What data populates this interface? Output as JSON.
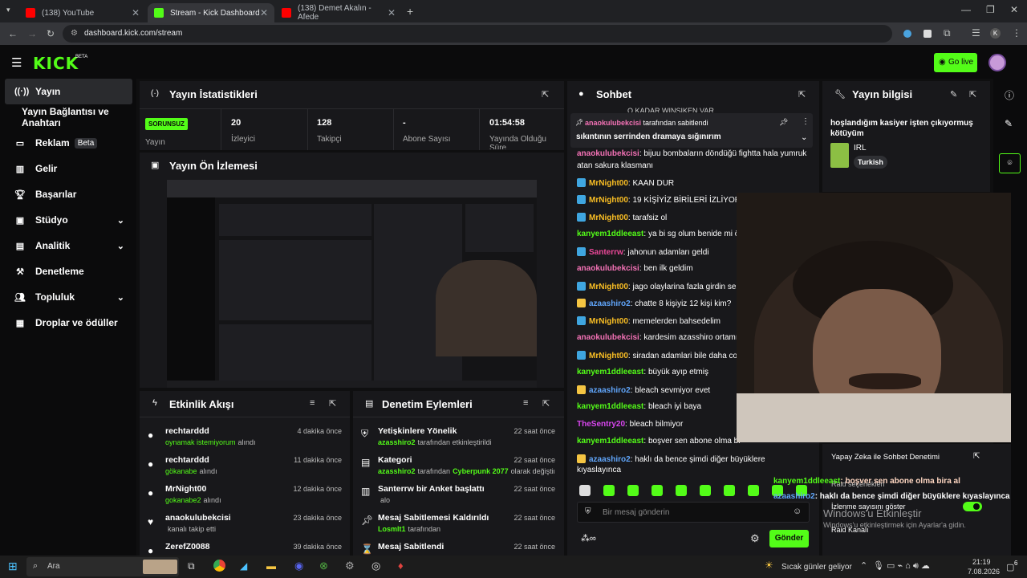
{
  "browser": {
    "tabs": [
      {
        "label": "(138) YouTube"
      },
      {
        "label": "Stream - Kick Dashboard"
      },
      {
        "label": "(138) Demet Akalın - Afede"
      }
    ],
    "url": "dashboard.kick.com/stream",
    "profile_letter": "K"
  },
  "header": {
    "logo": "KICK",
    "beta": "BETA",
    "go_live": "Go live"
  },
  "sidebar": {
    "items": [
      {
        "label": "Yayın"
      },
      {
        "label": "Yayın Bağlantısı ve Anahtarı"
      },
      {
        "label": "Reklam",
        "tag": "Beta"
      },
      {
        "label": "Gelir"
      },
      {
        "label": "Başarılar"
      },
      {
        "label": "Stüdyo"
      },
      {
        "label": "Analitik"
      },
      {
        "label": "Denetleme"
      },
      {
        "label": "Topluluk"
      },
      {
        "label": "Droplar ve ödüller"
      }
    ]
  },
  "stats": {
    "title": "Yayın İstatistikleri",
    "status": "SORUNSUZ",
    "status_label": "Yayın",
    "items": [
      {
        "value": "20",
        "label": "İzleyici"
      },
      {
        "value": "128",
        "label": "Takipçi"
      },
      {
        "value": "-",
        "label": "Abone Sayısı"
      },
      {
        "value": "01:54:58",
        "label": "Yayında Olduğu Süre"
      }
    ]
  },
  "preview": {
    "title": "Yayın Ön İzlemesi"
  },
  "activity": {
    "title": "Etkinlik Akışı",
    "items": [
      {
        "name": "rechtarddd",
        "sub": "oynamak istemiyorum",
        "suffix": "alındı",
        "time": "4 dakika önce"
      },
      {
        "name": "rechtarddd",
        "sub": "gökanabe",
        "suffix": "alındı",
        "time": "11 dakika önce"
      },
      {
        "name": "MrNight00",
        "sub": "gokanabe2",
        "suffix": "alındı",
        "time": "12 dakika önce"
      },
      {
        "name": "anaokulubekcisi",
        "sub": "",
        "suffix": "kanalı takip etti",
        "time": "23 dakika önce"
      },
      {
        "name": "ZerefZ0088",
        "sub": "",
        "suffix": "",
        "time": "39 dakika önce"
      }
    ]
  },
  "moderation": {
    "title": "Denetim Eylemleri",
    "items": [
      {
        "title": "Yetişkinlere Yönelik",
        "user": "azasshiro2",
        "rest": "tarafından etkinleştirildi",
        "time": "22 saat önce"
      },
      {
        "title": "Kategori",
        "user": "azasshiro2",
        "rest": "tarafından",
        "extra": "Cyberpunk 2077",
        "rest2": "olarak değiştirildi",
        "time": "22 saat önce"
      },
      {
        "title": "Santerrw bir Anket başlattı",
        "user": "",
        "rest": "alo",
        "time": "22 saat önce"
      },
      {
        "title": "Mesaj Sabitlemesi Kaldırıldı",
        "user": "Losmlt1",
        "rest": "tarafından",
        "time": "22 saat önce"
      },
      {
        "title": "Mesaj Sabitlendi",
        "user": "",
        "rest": "",
        "time": "22 saat önce"
      }
    ]
  },
  "chat": {
    "title": "Sohbet",
    "pinned_by_user": "anaokulubekcisi",
    "pinned_by_text": "tarafından sabitlendi",
    "pinned_message": "sıkıntının serrinden dramaya sığınırım",
    "top_cut": "O KADAR WINSIKEN VAR",
    "messages": [
      {
        "user": "anaokulubekcisi",
        "text": "bijuu bombaların döndüğü fightta hala yumruk",
        "cont": "atan sakura klasmanı",
        "color": "#f472b6"
      },
      {
        "user": "MrNight00",
        "text": "KAAN DUR",
        "color": "#fbbf24"
      },
      {
        "user": "MrNight00",
        "text": "19 KİŞİYİZ BİRİLERİ İZLİYOR",
        "color": "#fbbf24"
      },
      {
        "user": "MrNight00",
        "text": "tarafsiz ol",
        "color": "#fbbf24"
      },
      {
        "user": "kanyem1ddleeast",
        "text": "ya bi sg olum benide mi öl",
        "color": "#53fc18"
      },
      {
        "user": "Santerrw",
        "text": "jahonun adamları geldi",
        "color": "#ec4899"
      },
      {
        "user": "anaokulubekcisi",
        "text": "ben ilk geldim",
        "color": "#f472b6"
      },
      {
        "user": "MrNight00",
        "text": "jago olaylarina fazla girdin se",
        "color": "#fbbf24"
      },
      {
        "user": "azaashiro2",
        "text": "chatte 8 kişiyiz 12 kişi kim?",
        "color": "#60a5fa"
      },
      {
        "user": "MrNight00",
        "text": "memelerden bahsedelim",
        "color": "#fbbf24"
      },
      {
        "user": "anaokulubekcisi",
        "text": "kardesim azasshiro ortamı",
        "color": "#f472b6"
      },
      {
        "user": "MrNight00",
        "text": "siradan adamlari bile daha co",
        "color": "#fbbf24"
      },
      {
        "user": "kanyem1ddleeast",
        "text": "büyük ayıp etmiş",
        "color": "#53fc18"
      },
      {
        "user": "azaashiro2",
        "text": "bleach sevmiyor evet",
        "color": "#60a5fa"
      },
      {
        "user": "kanyem1ddleeast",
        "text": "bleach iyi baya",
        "color": "#53fc18"
      },
      {
        "user": "TheSentry20",
        "text": "bleach bilmiyor",
        "color": "#d946ef"
      },
      {
        "user": "kanyem1ddleeast",
        "text": "boşver sen abone olma bi",
        "color": "#53fc18"
      },
      {
        "user": "azaashiro2",
        "text": "haklı da bence şimdi diğer büyüklere",
        "cont": "kıyaslayınca",
        "color": "#60a5fa"
      }
    ],
    "placeholder": "Bir mesaj gönderin",
    "send": "Gönder"
  },
  "info": {
    "title": "Yayın bilgisi",
    "stream_title": "hoşlandığım kasiyer işten çıkıyormuş kötüyüm",
    "category": "IRL",
    "language": "Turkish"
  },
  "overlay": {
    "ai_title": "Yapay Zeka ile Sohbet Denetimi",
    "raid_sel": "Raid seçenekleri",
    "viewcount": "İzlenme sayısını göster",
    "raid": "Raid Kanalı",
    "win1": "Windows'u Etkinleştir",
    "win2": "Windows'u etkinleştirmek için Ayarlar'a gidin.",
    "chat1_user": "kanyem1ddleeast",
    "chat1_text": ": boşver sen abone olma bira al",
    "chat2_user": "azaashiro2",
    "chat2_text": ": haklı da bence şimdi diğer büyüklere kıyaslayınca"
  },
  "taskbar": {
    "search": "Ara",
    "weather": "Sıcak günler geliyor",
    "time": "21:19",
    "date": "7.08.2026",
    "notif": "6"
  }
}
